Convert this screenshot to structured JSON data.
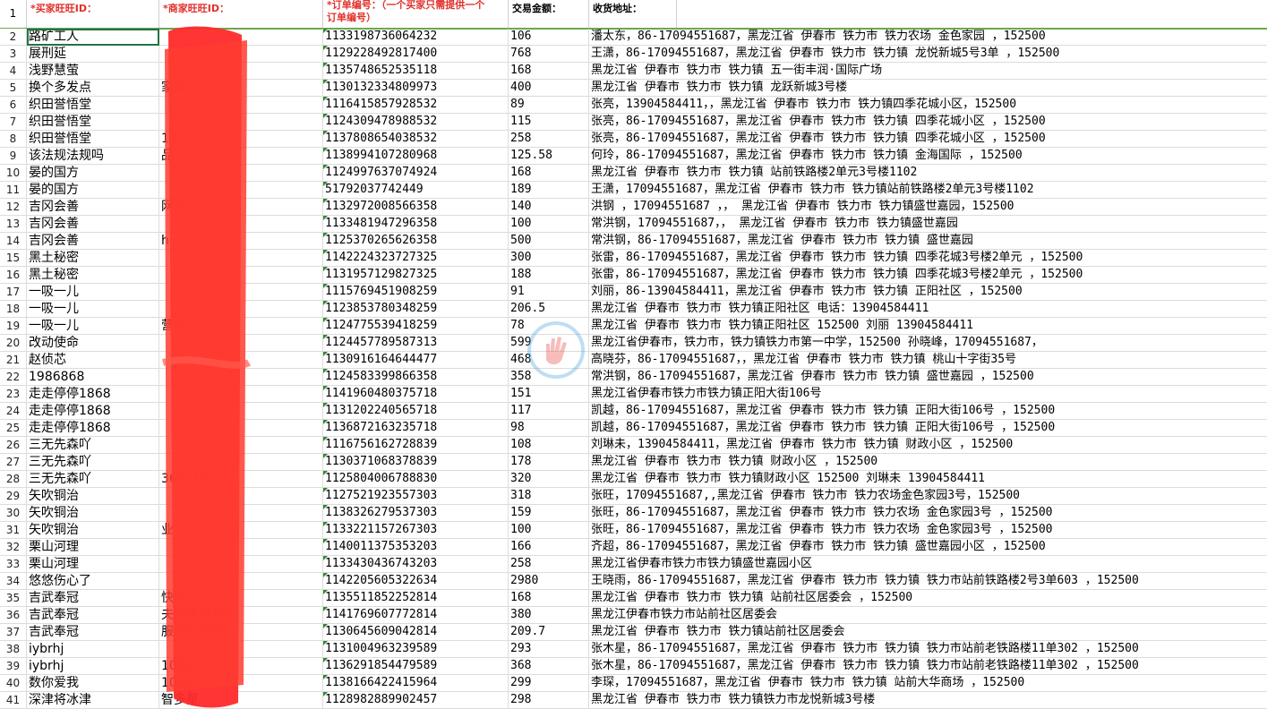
{
  "headers": {
    "buyer": "*买家旺旺ID：",
    "seller": "*商家旺旺ID：",
    "order_line1": "*订单编号：（一个买家只需提供一个",
    "order_line2": "订单编号）",
    "amount": "交易金额：",
    "address": "收货地址："
  },
  "header_row_number": "1",
  "colors": {
    "header_red": "#e0302a",
    "selection": "#217346",
    "redaction": "#ff2a2a",
    "grid": "#dcdcdc"
  },
  "rows": [
    {
      "n": "2",
      "buyer": "路矿工人",
      "seller": "",
      "order": "1133198736064232",
      "amount": "106",
      "addr": " 潘太东，86-17094551687，黑龙江省 伊春市 铁力市 铁力农场 金色家园 ，152500"
    },
    {
      "n": "3",
      "buyer": "展刑延",
      "seller": "",
      "order": "1129228492817400",
      "amount": "768",
      "addr": "王潇，86-17094551687，黑龙江省 伊春市 铁力市 铁力镇 龙悦新城5号3单 ，152500"
    },
    {
      "n": "4",
      "buyer": "浅野慧萤",
      "seller": "",
      "order": "1135748652535118",
      "amount": "168",
      "addr": "黑龙江省 伊春市 铁力市 铁力镇 五一街丰润·国际广场"
    },
    {
      "n": "5",
      "buyer": "换个多发点",
      "seller": "家具",
      "order": "1130132334809973",
      "amount": "400",
      "addr": "黑龙江省 伊春市 铁力市 铁力镇 龙跃新城3号楼"
    },
    {
      "n": "6",
      "buyer": "织田誉悟堂",
      "seller": "",
      "order": "1116415857928532",
      "amount": "89",
      "addr": "张亮，13904584411，，黑龙江省 伊春市 铁力市 铁力镇四季花城小区，152500"
    },
    {
      "n": "7",
      "buyer": "织田誉悟堂",
      "seller": "",
      "order": "1124309478988532",
      "amount": "115",
      "addr": "张亮，86-17094551687，黑龙江省 伊春市 铁力市 铁力镇 四季花城小区 ，152500"
    },
    {
      "n": "8",
      "buyer": "织田誉悟堂",
      "seller": "13",
      "order": "1137808654038532",
      "amount": "258",
      "addr": "张亮，86-17094551687，黑龙江省 伊春市 铁力市 铁力镇 四季花城小区 ，152500"
    },
    {
      "n": "9",
      "buyer": "该法规法规吗",
      "seller": "品",
      "order": "1138994107280968",
      "amount": "125.58",
      "addr": "何玲，86-17094551687，黑龙江省 伊春市 铁力市 铁力镇 金海国际 ，152500"
    },
    {
      "n": "10",
      "buyer": "晏的国方",
      "seller": "",
      "order": "1124997637074924",
      "amount": "168",
      "addr": "黑龙江省 伊春市 铁力市 铁力镇 站前铁路楼2单元3号楼1102"
    },
    {
      "n": "11",
      "buyer": "晏的国方",
      "seller": "",
      "order": "51792037742449",
      "amount": "189",
      "addr": "王潇，17094551687，黑龙江省 伊春市 铁力市 铁力镇站前铁路楼2单元3号楼1102"
    },
    {
      "n": "12",
      "buyer": "吉冈会善",
      "seller": "网点",
      "order": "1132972008566358",
      "amount": "140",
      "addr": "洪钢 ，17094551687 ，， 黑龙江省 伊春市 铁力市 铁力镇盛世嘉园，152500"
    },
    {
      "n": "13",
      "buyer": "吉冈会善",
      "seller": "",
      "order": "1133481947296358",
      "amount": "100",
      "addr": "常洪钢，17094551687，， 黑龙江省 伊春市 铁力市 铁力镇盛世嘉园"
    },
    {
      "n": "14",
      "buyer": "吉冈会善",
      "seller": "h",
      "order": "1125370265626358",
      "amount": "500",
      "addr": "常洪钢，86-17094551687，黑龙江省 伊春市 铁力市 铁力镇 盛世嘉园"
    },
    {
      "n": "15",
      "buyer": "黑土秘密",
      "seller": "",
      "order": "1142224323727325",
      "amount": "300",
      "addr": "张雷，86-17094551687，黑龙江省 伊春市 铁力市 铁力镇 四季花城3号楼2单元 ，152500"
    },
    {
      "n": "16",
      "buyer": "黑土秘密",
      "seller": "",
      "order": "1131957129827325",
      "amount": "188",
      "addr": "张雷，86-17094551687，黑龙江省 伊春市 铁力市 铁力镇 四季花城3号楼2单元 ，152500"
    },
    {
      "n": "17",
      "buyer": "一吸一儿",
      "seller": "",
      "order": "1115769451908259",
      "amount": "91",
      "addr": "刘丽，86-13904584411，黑龙江省 伊春市 铁力市 铁力镇 正阳社区 ，152500"
    },
    {
      "n": "18",
      "buyer": "一吸一儿",
      "seller": "",
      "order": "1123853780348259",
      "amount": "206.5",
      "addr": "黑龙江省 伊春市 铁力市 铁力镇正阳社区 电话：13904584411"
    },
    {
      "n": "19",
      "buyer": "一吸一儿",
      "seller": "营店",
      "order": "1124775539418259",
      "amount": "78",
      "addr": "黑龙江省  伊春市  铁力市  铁力镇正阳社区  152500  刘丽  13904584411"
    },
    {
      "n": "20",
      "buyer": "改动使命",
      "seller": "",
      "order": "1124457789587313",
      "amount": "599",
      "addr": "黑龙江省伊春市，铁力市，铁力镇铁力市第一中学，152500 孙晓峰，17094551687，"
    },
    {
      "n": "21",
      "buyer": "赵侦芯",
      "seller": "",
      "order": "1130916164644477",
      "amount": "468",
      "addr": "高晓芬，86-17094551687，，黑龙江省 伊春市 铁力市 铁力镇 桃山十字街35号"
    },
    {
      "n": "22",
      "buyer": "1986868",
      "seller": "",
      "order": "1124583399866358",
      "amount": "358",
      "addr": "常洪钢，86-17094551687，黑龙江省 伊春市 铁力市 铁力镇 盛世嘉园 ，152500"
    },
    {
      "n": "23",
      "buyer": "走走停停1868",
      "seller": "",
      "order": "1141960480375718",
      "amount": "151",
      "addr": "黑龙江省伊春市铁力市铁力镇正阳大街106号"
    },
    {
      "n": "24",
      "buyer": "走走停停1868",
      "seller": "",
      "order": "1131202240565718",
      "amount": "117",
      "addr": "凯越，86-17094551687，黑龙江省 伊春市 铁力市 铁力镇 正阳大街106号 ，152500"
    },
    {
      "n": "25",
      "buyer": "走走停停1868",
      "seller": "",
      "order": "1136872163235718",
      "amount": "98",
      "addr": "凯越，86-17094551687，黑龙江省 伊春市 铁力市 铁力镇 正阳大街106号 ，152500"
    },
    {
      "n": "26",
      "buyer": "三无先森吖",
      "seller": "",
      "order": "1116756162728839",
      "amount": "108",
      "addr": "刘琳未，13904584411，黑龙江省 伊春市 铁力市 铁力镇 财政小区 ，152500"
    },
    {
      "n": "27",
      "buyer": "三无先森吖",
      "seller": "",
      "order": "1130371068378839",
      "amount": "178",
      "addr": "黑龙江省 伊春市 铁力市 铁力镇 财政小区 ，152500"
    },
    {
      "n": "28",
      "buyer": "三无先森吖",
      "seller": "365219",
      "order": "1125804006788830",
      "amount": "320",
      "addr": "黑龙江省  伊春市  铁力市  铁力镇财政小区  152500  刘琳未  13904584411"
    },
    {
      "n": "29",
      "buyer": "矢吹铜治",
      "seller": "",
      "order": "1127521923557303",
      "amount": "318",
      "addr": "张旺，17094551687,,黑龙江省 伊春市 铁力市 铁力农场金色家园3号，152500"
    },
    {
      "n": "30",
      "buyer": "矢吹铜治",
      "seller": "",
      "order": "1138326279537303",
      "amount": "159",
      "addr": "张旺，86-17094551687，黑龙江省 伊春市 铁力市 铁力农场 金色家园3号 ，152500"
    },
    {
      "n": "31",
      "buyer": "矢吹铜治",
      "seller": "业",
      "order": "1133221157267303",
      "amount": "100",
      "addr": "张旺，86-17094551687，黑龙江省 伊春市 铁力市 铁力农场 金色家园3号 ，152500"
    },
    {
      "n": "32",
      "buyer": "栗山河理",
      "seller": "",
      "order": "1140011375353203",
      "amount": "166",
      "addr": "齐超，86-17094551687，黑龙江省 伊春市 铁力市 铁力镇 盛世嘉园小区 ，152500"
    },
    {
      "n": "33",
      "buyer": "栗山河理",
      "seller": "",
      "order": "1133430436743203",
      "amount": "258",
      "addr": "黑龙江省伊春市铁力市铁力镇盛世嘉园小区"
    },
    {
      "n": "34",
      "buyer": "悠悠伤心了",
      "seller": "",
      "order": "1142205605322634",
      "amount": "2980",
      "addr": "王晓雨，86-17094551687，黑龙江省 伊春市 铁力市 铁力镇 铁力市站前铁路楼2号3单603 ，152500"
    },
    {
      "n": "35",
      "buyer": "吉武奉冠",
      "seller": "快乐",
      "order": "1135511852252814",
      "amount": "168",
      "addr": "黑龙江省 伊春市 铁力市 铁力镇 站前社区居委会 ，152500"
    },
    {
      "n": "36",
      "buyer": "吉武奉冠",
      "seller": "夫网络用品店",
      "order": "1141769607772814",
      "amount": "380",
      "addr": "黑龙江伊春市铁力市站前社区居委会"
    },
    {
      "n": "37",
      "buyer": "吉武奉冠",
      "seller": "服饰专营店",
      "order": "1130645609042814",
      "amount": "209.7",
      "addr": "黑龙江省 伊春市 铁力市 铁力镇站前社区居委会"
    },
    {
      "n": "38",
      "buyer": "iybrhj",
      "seller": "",
      "order": "1131004963239589",
      "amount": "293",
      "addr": "张木星，86-17094551687，黑龙江省 伊春市 铁力市 铁力镇 铁力市站前老铁路楼11单302 ，152500"
    },
    {
      "n": "39",
      "buyer": "iybrhj",
      "seller": "1002",
      "order": "1136291854479589",
      "amount": "368",
      "addr": "张木星，86-17094551687，黑龙江省 伊春市 铁力市 铁力镇 铁力市站前老铁路楼11单302 ，152500"
    },
    {
      "n": "40",
      "buyer": "数你爱我",
      "seller": "1002",
      "order": "1138166422415964",
      "amount": "299",
      "addr": "李琛，17094551687，黑龙江省 伊春市 铁力市 铁力镇 站前大华商场 ，152500"
    },
    {
      "n": "41",
      "buyer": "深津将冰津",
      "seller": "智多星",
      "order": "1128982889902457",
      "amount": "298",
      "addr": "黑龙江省 伊春市 铁力市 铁力镇铁力市龙悦新城3号楼"
    }
  ]
}
